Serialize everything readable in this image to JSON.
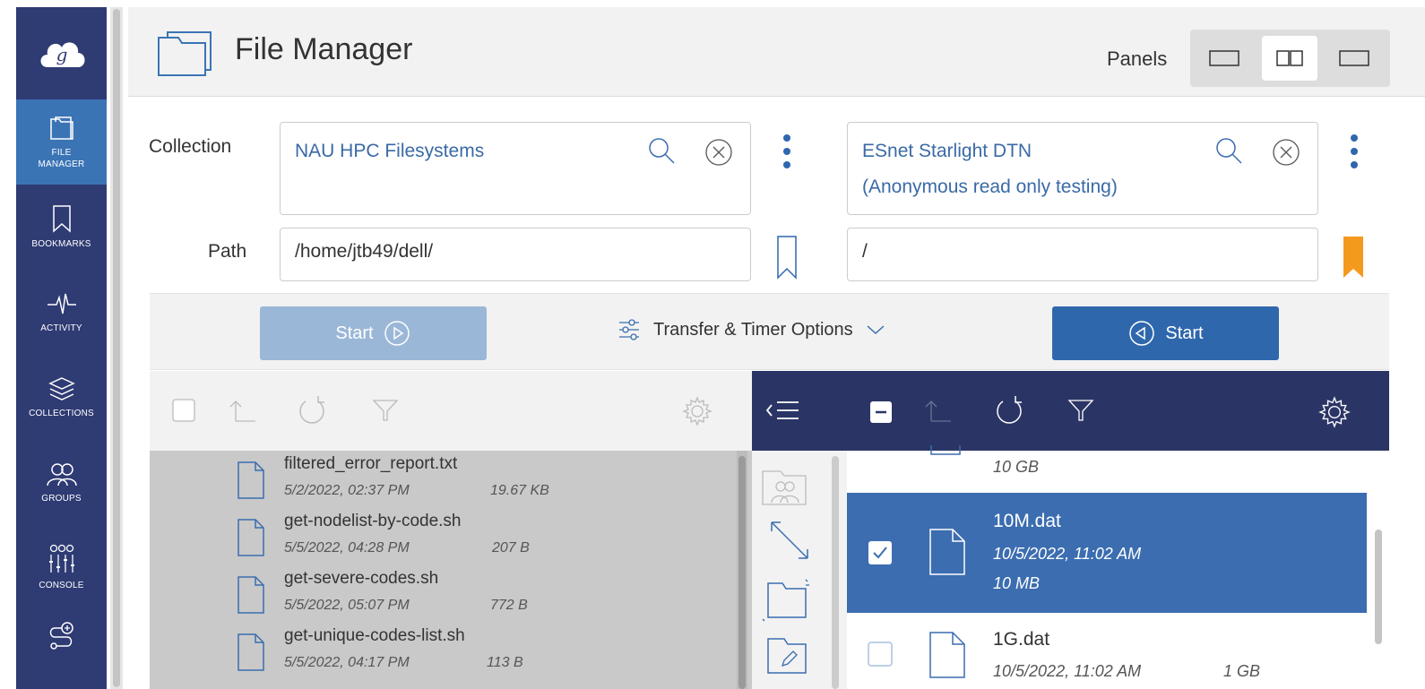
{
  "nav": {
    "items": [
      {
        "label": "FILE\nMANAGER",
        "l1": "FILE",
        "l2": "MANAGER"
      },
      {
        "label": "BOOKMARKS"
      },
      {
        "label": "ACTIVITY"
      },
      {
        "label": "COLLECTIONS"
      },
      {
        "label": "GROUPS"
      },
      {
        "label": "CONSOLE"
      }
    ]
  },
  "header": {
    "title": "File Manager",
    "panels_label": "Panels"
  },
  "labels": {
    "collection": "Collection",
    "path": "Path"
  },
  "left": {
    "collection": "NAU HPC Filesystems",
    "path": "/home/jtb49/dell/",
    "files": [
      {
        "name": "filtered_error_report.txt",
        "date": "5/2/2022, 02:37 PM",
        "size": "19.67 KB"
      },
      {
        "name": "get-nodelist-by-code.sh",
        "date": "5/5/2022, 04:28 PM",
        "size": "207 B"
      },
      {
        "name": "get-severe-codes.sh",
        "date": "5/5/2022, 05:07 PM",
        "size": "772 B"
      },
      {
        "name": "get-unique-codes-list.sh",
        "date": "5/5/2022, 04:17 PM",
        "size": "113 B"
      }
    ]
  },
  "right": {
    "collection_line1": "ESnet Starlight DTN",
    "collection_line2": "(Anonymous read only testing)",
    "path": "/",
    "files": [
      {
        "name": "",
        "date": "",
        "size": "10 GB"
      },
      {
        "name": "10M.dat",
        "date": "10/5/2022, 11:02 AM",
        "size": "10 MB",
        "selected": true
      },
      {
        "name": "1G.dat",
        "date": "10/5/2022, 11:02 AM",
        "size": "1 GB",
        "selected": false
      }
    ]
  },
  "transfer": {
    "start_left": "Start",
    "start_right": "Start",
    "options": "Transfer & Timer Options"
  },
  "colors": {
    "nav_bg": "#2f3b73",
    "accent": "#2f67ad",
    "selected_row": "#3b6db0",
    "bookmark_active": "#f39a1e"
  }
}
